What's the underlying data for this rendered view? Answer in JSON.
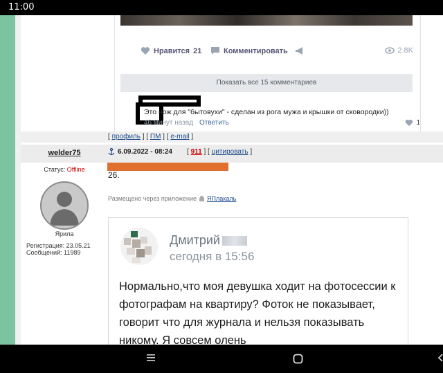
{
  "status_bar": {
    "time": "11:00"
  },
  "vk_post": {
    "like_label": "Нравится",
    "like_count": "21",
    "comment_label": "Комментировать",
    "views": "2.8K",
    "show_all_comments": "Показать все 15 комментариев",
    "comment": {
      "text": "Это нож для \"бытовухи\" - сделан из рога мужа и крышки от сковородки))",
      "time": "46 минут назад",
      "reply": "Ответить",
      "likes": "1"
    }
  },
  "post_links": {
    "profile": "профиль",
    "pm": "ПМ",
    "email": "e-mail"
  },
  "post2": {
    "author": "welder75",
    "status_label": "Статус:",
    "status_value": "Offline",
    "rank": "Ярила",
    "registration": "Регистрация: 23.05.21",
    "messages": "Сообщений: 11989",
    "date": "6.09.2022 - 08:24",
    "number": "911",
    "quote": "цитировать",
    "body": "26.",
    "posted_via_label": "Размещено через приложение",
    "posted_via_app": "ЯПлакаль"
  },
  "screenshot": {
    "name": "Дмитрий",
    "time": "сегодня в 15:56",
    "text": "Нормально,что моя девушка ходит на фотосессии к фотографам на квартиру? Фоток не показывает, говорит что для журнала и нельзя показывать никому. Я совсем олень"
  },
  "colors": {
    "left_bar": "#7cc4a0",
    "redaction": "#e07030",
    "link": "#1a4a8a",
    "offline": "#cc0000"
  }
}
